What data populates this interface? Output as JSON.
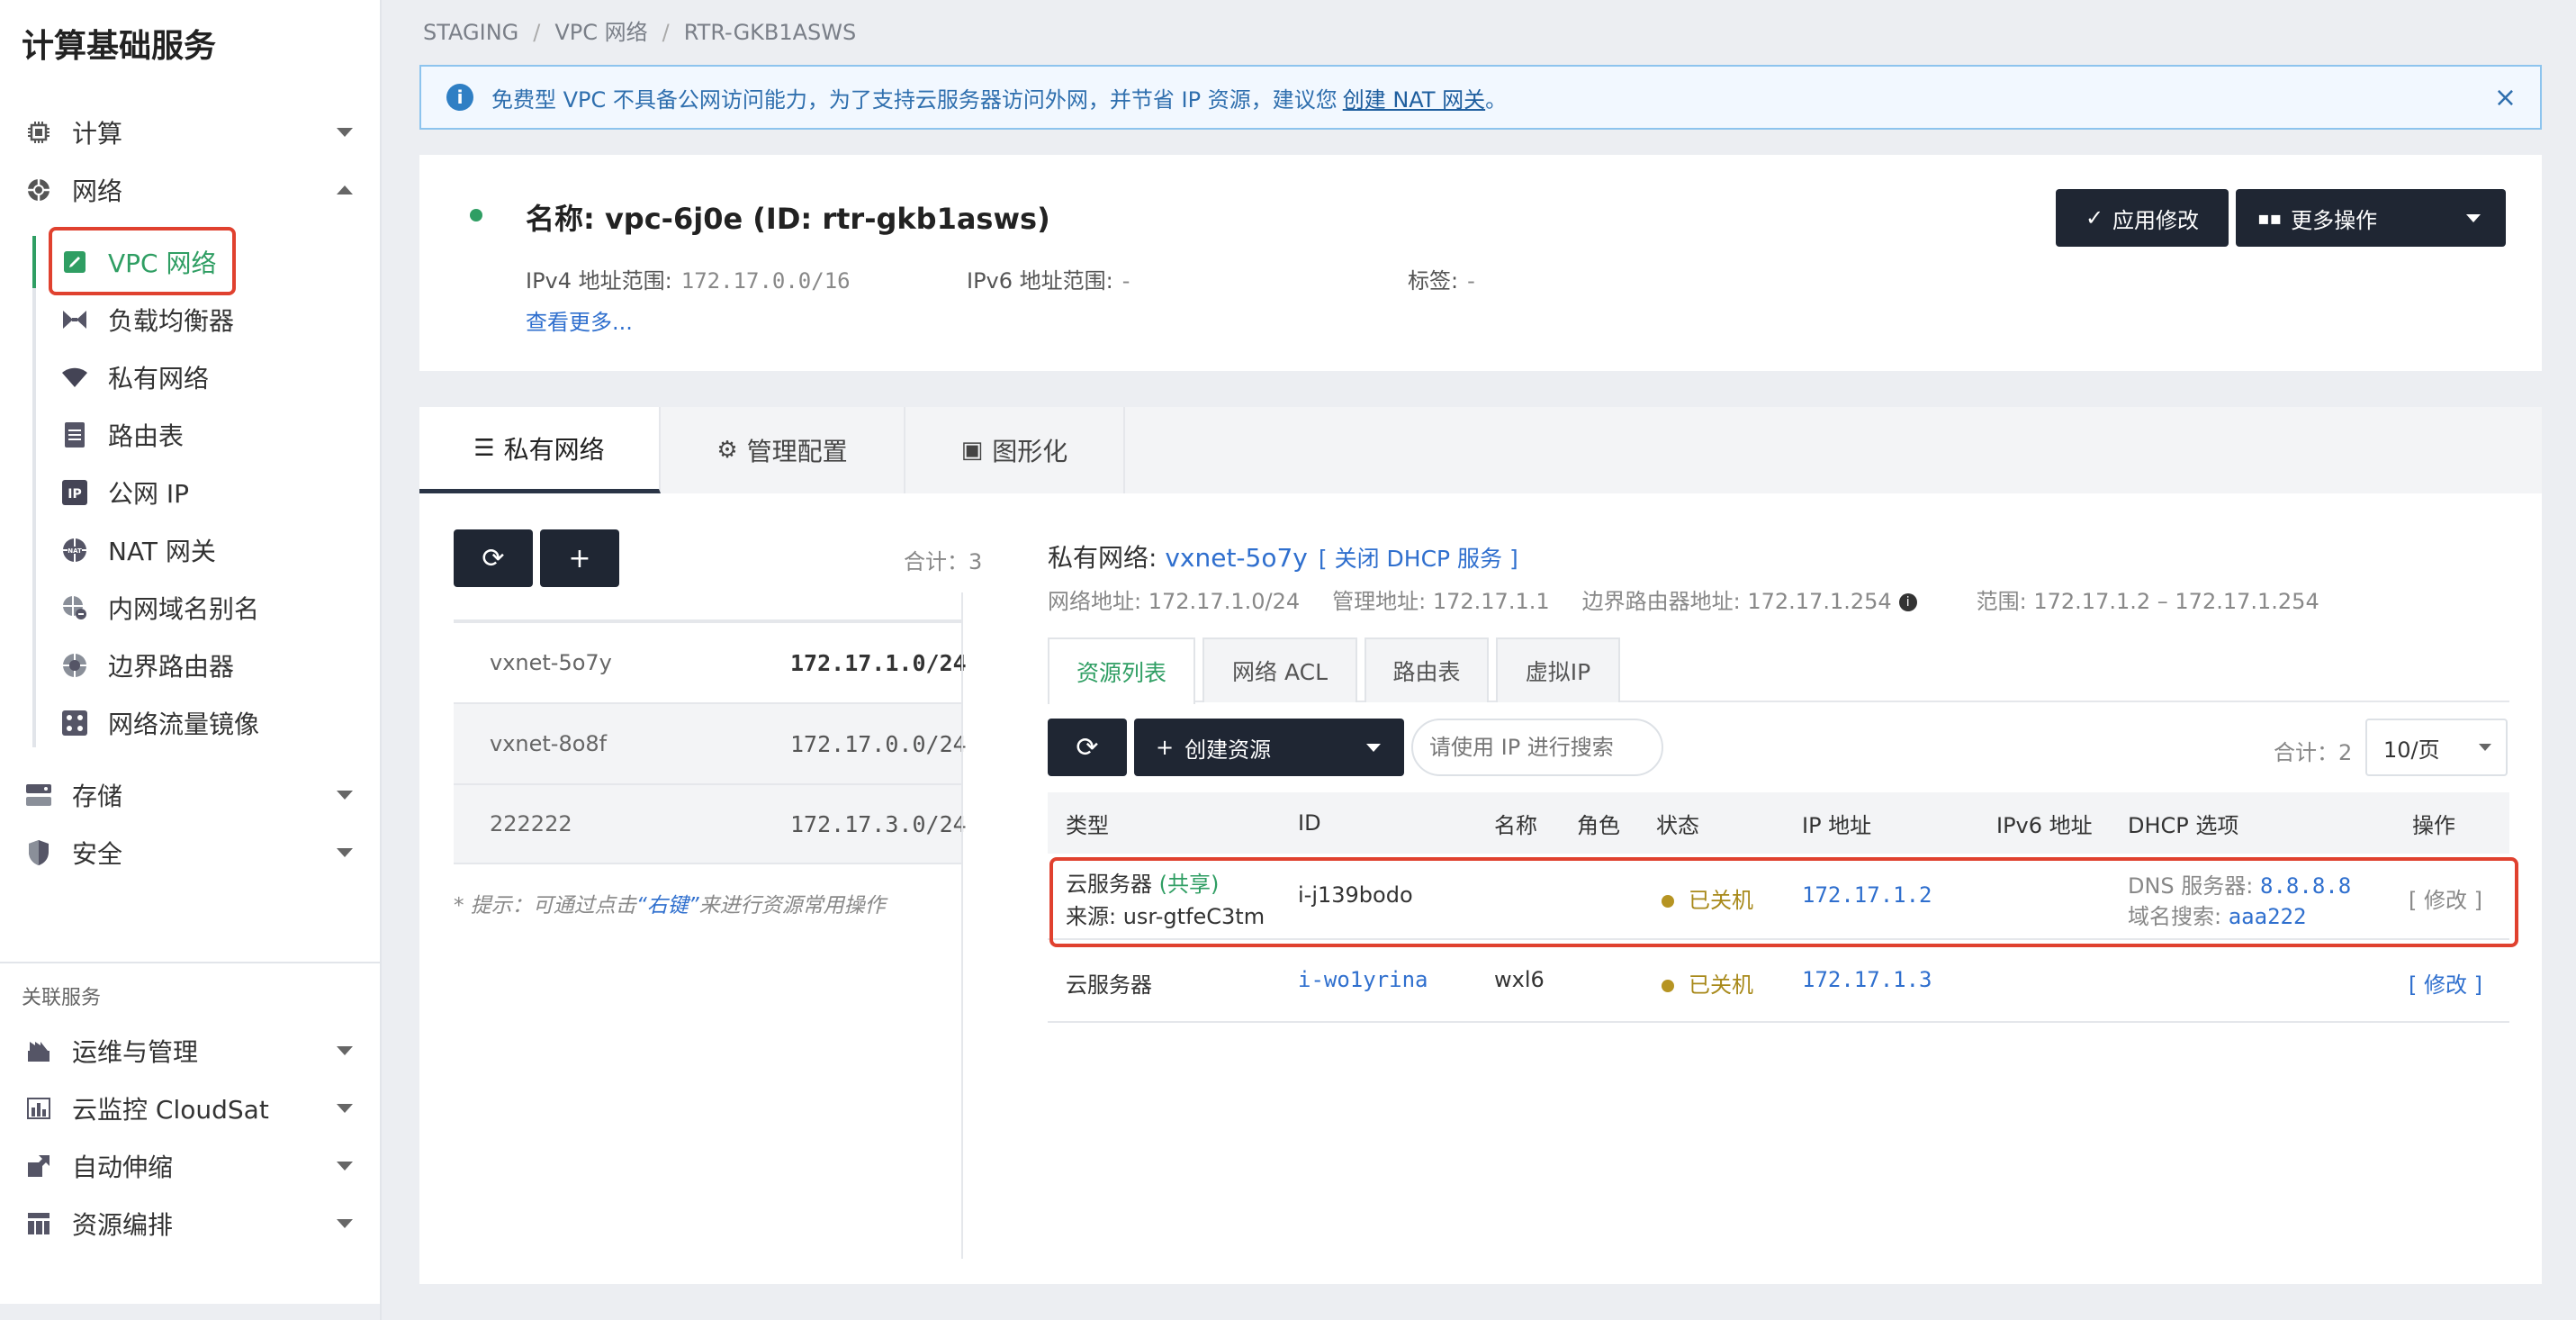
{
  "sidebar": {
    "title": "计算基础服务",
    "groups": [
      {
        "label": "计算",
        "icon": "cpu-icon"
      },
      {
        "label": "网络",
        "icon": "network-icon"
      },
      {
        "label": "存储",
        "icon": "storage-icon"
      },
      {
        "label": "安全",
        "icon": "shield-icon"
      }
    ],
    "network_items": [
      {
        "label": "VPC 网络",
        "icon": "vpc-icon"
      },
      {
        "label": "负载均衡器",
        "icon": "load-balancer-icon"
      },
      {
        "label": "私有网络",
        "icon": "wifi-icon"
      },
      {
        "label": "路由表",
        "icon": "document-icon"
      },
      {
        "label": "公网 IP",
        "icon": "ip-icon"
      },
      {
        "label": "NAT 网关",
        "icon": "nat-icon"
      },
      {
        "label": "内网域名别名",
        "icon": "dns-icon"
      },
      {
        "label": "边界路由器",
        "icon": "router-icon"
      },
      {
        "label": "网络流量镜像",
        "icon": "mirror-icon"
      }
    ],
    "related_section": "关联服务",
    "related": [
      {
        "label": "运维与管理",
        "icon": "ops-icon"
      },
      {
        "label": "云监控 CloudSat",
        "icon": "monitor-icon"
      },
      {
        "label": "自动伸缩",
        "icon": "autoscale-icon"
      },
      {
        "label": "资源编排",
        "icon": "orchestration-icon"
      }
    ]
  },
  "breadcrumb": [
    "STAGING",
    "VPC 网络",
    "RTR-GKB1ASWS"
  ],
  "alert": {
    "text": "免费型 VPC 不具备公网访问能力，为了支持云服务器访问外网，并节省 IP 资源，建议您",
    "link": "创建 NAT 网关",
    "end": "。",
    "close": "×"
  },
  "vpc": {
    "title": "名称: vpc-6j0e (ID: rtr-gkb1asws)",
    "ipv4_label": "IPv4 地址范围:",
    "ipv4_value": "172.17.0.0/16",
    "ipv6_label": "IPv6 地址范围:",
    "ipv6_value": "-",
    "tag_label": "标签:",
    "tag_value": "-",
    "more": "查看更多...",
    "apply_btn": "应用修改",
    "more_ops_btn": "更多操作",
    "status_color": "#2f9e63"
  },
  "tabs": [
    {
      "label": "私有网络",
      "icon": "list-icon"
    },
    {
      "label": "管理配置",
      "icon": "gears-icon"
    },
    {
      "label": "图形化",
      "icon": "image-icon"
    }
  ],
  "left_panel": {
    "refresh": "⟳",
    "add": "+",
    "count": "合计：3",
    "networks": [
      {
        "name": "vxnet-5o7y",
        "cidr": "172.17.1.0/24"
      },
      {
        "name": "vxnet-8o8f",
        "cidr": "172.17.0.0/24"
      },
      {
        "name": "222222",
        "cidr": "172.17.3.0/24"
      }
    ],
    "hint_prefix": "* 提示：可通过点击",
    "hint_key": "“右键”",
    "hint_suffix": "来进行资源常用操作"
  },
  "right_panel": {
    "title_label": "私有网络:",
    "title_link": "vxnet-5o7y",
    "dhcp_link": "[ 关闭 DHCP 服务 ]",
    "net_addr": "网络地址: 172.17.1.0/24",
    "mgmt_addr": "管理地址: 172.17.1.1",
    "border_addr": "边界路由器地址: 172.17.1.254",
    "range": "范围: 172.17.1.2 – 172.17.1.254",
    "subtabs": [
      "资源列表",
      "网络 ACL",
      "路由表",
      "虚拟IP"
    ],
    "create_btn": "创建资源",
    "search_placeholder": "请使用 IP 进行搜索",
    "count": "合计：2",
    "page_size": "10/页",
    "columns": [
      "类型",
      "ID",
      "名称",
      "角色",
      "状态",
      "IP 地址",
      "IPv6 地址",
      "DHCP 选项",
      "操作"
    ],
    "rows": [
      {
        "type": "云服务器",
        "shared": "(共享)",
        "source": "来源: usr-gtfeC3tm",
        "id": "i-j139bodo",
        "name": "",
        "role": "",
        "status": "已关机",
        "ip": "172.17.1.2",
        "ipv6": "",
        "dns_label": "DNS 服务器:",
        "dns_value": "8.8.8.8",
        "domain_label": "域名搜索:",
        "domain_value": "aaa222",
        "action": "[ 修改 ]"
      },
      {
        "type": "云服务器",
        "id": "i-wo1yrina",
        "name": "wxl6",
        "role": "",
        "status": "已关机",
        "ip": "172.17.1.3",
        "ipv6": "",
        "action": "[ 修改 ]"
      }
    ]
  }
}
